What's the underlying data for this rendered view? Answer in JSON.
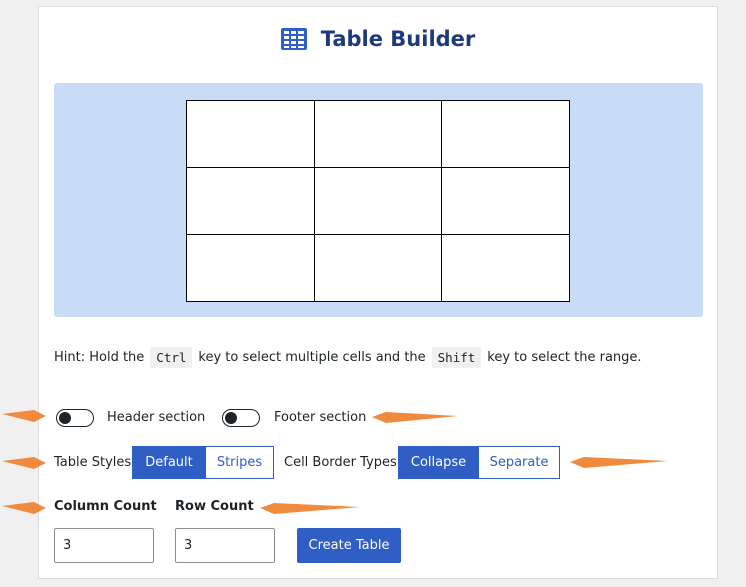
{
  "header": {
    "title": "Table Builder",
    "icon": "table-icon"
  },
  "preview": {
    "rows": 3,
    "columns": 3
  },
  "hint": {
    "prefix": "Hint: Hold the",
    "key1": "Ctrl",
    "middle": "key to select multiple cells and the",
    "key2": "Shift",
    "suffix": "key to select the range."
  },
  "toggles": {
    "header_label": "Header section",
    "footer_label": "Footer section"
  },
  "styles": {
    "label": "Table Styles",
    "default": "Default",
    "stripes": "Stripes"
  },
  "borders": {
    "label": "Cell Border Types",
    "collapse": "Collapse",
    "separate": "Separate"
  },
  "counts": {
    "column_label": "Column Count",
    "row_label": "Row Count",
    "column_value": "3",
    "row_value": "3"
  },
  "create_label": "Create Table",
  "colors": {
    "accent": "#2f5ec4",
    "title": "#1e3a7b",
    "preview_bg": "#c8dcf8",
    "arrow": "#f08a3c"
  }
}
